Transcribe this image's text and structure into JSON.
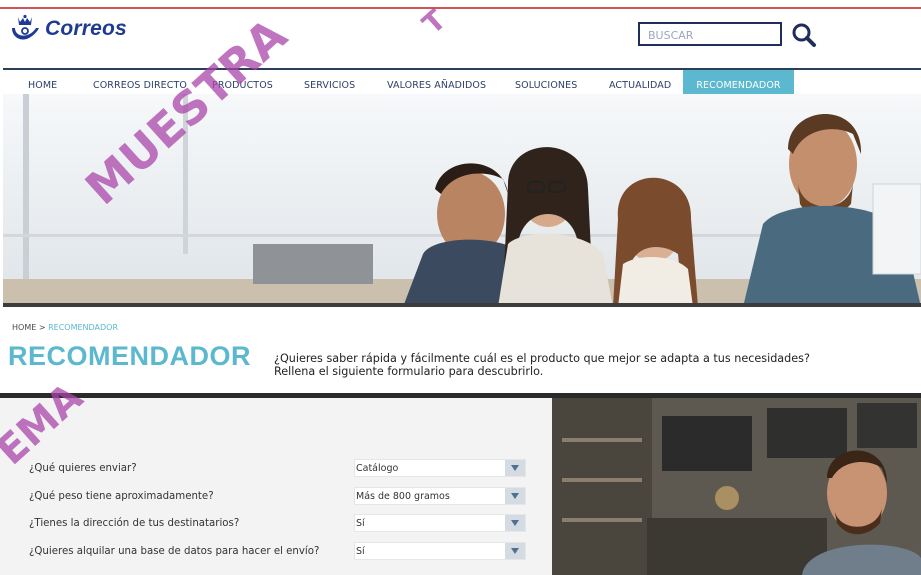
{
  "header": {
    "brand": "Correos",
    "search": {
      "placeholder": "BUSCAR",
      "value": ""
    }
  },
  "nav": {
    "items": [
      {
        "label": "HOME"
      },
      {
        "label": "CORREOS DIRECTO"
      },
      {
        "label": "PRODUCTOS"
      },
      {
        "label": "SERVICIOS"
      },
      {
        "label": "VALORES AÑADIDOS"
      },
      {
        "label": "SOLUCIONES"
      },
      {
        "label": "ACTUALIDAD"
      },
      {
        "label": "RECOMENDADOR"
      }
    ],
    "active_index": 7
  },
  "breadcrumb": {
    "home": "HOME",
    "separator": " > ",
    "current": "RECOMENDADOR"
  },
  "page": {
    "title": "RECOMENDADOR",
    "intro_line1": "¿Quieres saber rápida y fácilmente cuál es el producto que mejor se adapta a tus necesidades?",
    "intro_line2": "Rellena el siguiente formulario para descubrirlo."
  },
  "form": {
    "questions": [
      {
        "label": "¿Qué quieres enviar?",
        "value": "Catálogo"
      },
      {
        "label": "¿Qué peso tiene aproximadamente?",
        "value": "Más de 800 gramos"
      },
      {
        "label": "¿Tienes la dirección de tus destinatarios?",
        "value": "Sí"
      },
      {
        "label": "¿Quieres alquilar una base de datos para hacer el envío?",
        "value": "Sí"
      }
    ]
  },
  "watermark": {
    "text1": "MUESTRA",
    "text2": "EMA",
    "text3": "T"
  },
  "colors": {
    "brand_blue": "#1f3a93",
    "accent": "#5bb8cf",
    "nav_text": "#2b3f66",
    "watermark": "#aa46aa"
  },
  "icons": {
    "logo": "crown-horn-icon",
    "search": "magnifier-icon",
    "select_arrow": "chevron-down-icon"
  }
}
